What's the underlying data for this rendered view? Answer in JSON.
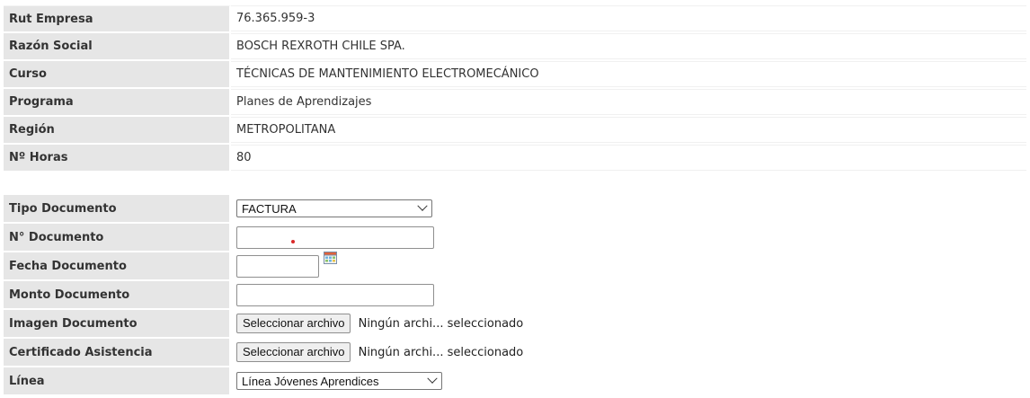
{
  "empresa": {
    "rows": [
      {
        "label": "Rut Empresa",
        "value": "76.365.959-3"
      },
      {
        "label": "Razón Social",
        "value": "BOSCH REXROTH CHILE SPA."
      },
      {
        "label": "Curso",
        "value": "TÉCNICAS DE MANTENIMIENTO ELECTROMECÁNICO"
      },
      {
        "label": "Programa",
        "value": "Planes de Aprendizajes"
      },
      {
        "label": "Región",
        "value": "METROPOLITANA"
      },
      {
        "label": "Nº Horas",
        "value": "80"
      }
    ]
  },
  "documento": {
    "tipo": {
      "label": "Tipo Documento",
      "selected": "FACTURA"
    },
    "numero": {
      "label": "N° Documento",
      "value": "",
      "placeholder": ""
    },
    "fecha": {
      "label": "Fecha Documento",
      "value": "",
      "icon": "calendar-icon"
    },
    "monto": {
      "label": "Monto Documento",
      "value": ""
    },
    "imagen": {
      "label": "Imagen Documento",
      "button": "Seleccionar archivo",
      "status": "Ningún archi... seleccionado"
    },
    "certificado": {
      "label": "Certificado Asistencia",
      "button": "Seleccionar archivo",
      "status": "Ningún archi... seleccionado"
    },
    "linea": {
      "label": "Línea",
      "selected": "Línea Jóvenes Aprendices"
    }
  },
  "colors": {
    "label_bg": "#e6e6e6",
    "required_dot": "#d92a2a"
  }
}
